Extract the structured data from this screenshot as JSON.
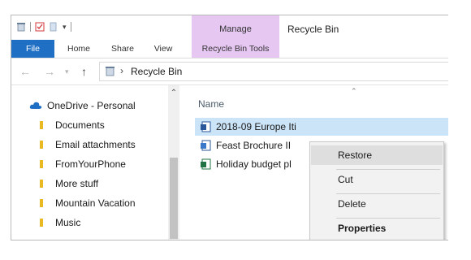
{
  "window": {
    "title": "Recycle Bin"
  },
  "ribbon": {
    "context_group": "Manage",
    "tabs": [
      "File",
      "Home",
      "Share",
      "View"
    ],
    "context_tab": "Recycle Bin Tools"
  },
  "address": {
    "path": "Recycle Bin",
    "separator": "›"
  },
  "nav_pane": {
    "onedrive": "OneDrive - Personal",
    "items": [
      "Documents",
      "Email attachments",
      "FromYourPhone",
      "More stuff",
      "Mountain Vacation",
      "Music"
    ]
  },
  "file_list": {
    "column_name": "Name",
    "files": [
      {
        "name": "2018-09 Europe Iti",
        "type": "word-doc",
        "selected": true
      },
      {
        "name": "Feast Brochure II",
        "type": "publisher-doc",
        "selected": false
      },
      {
        "name": "Holiday budget pl",
        "type": "excel-sheet",
        "selected": false
      }
    ]
  },
  "context_menu": {
    "items": [
      "Restore",
      "Cut",
      "Delete",
      "Properties"
    ]
  },
  "colors": {
    "file_tab": "#1f6fc5",
    "manage_band": "#e6c7f2",
    "selection": "#cce4f7",
    "folder": "#e8b923",
    "onedrive": "#1f6fc5"
  }
}
